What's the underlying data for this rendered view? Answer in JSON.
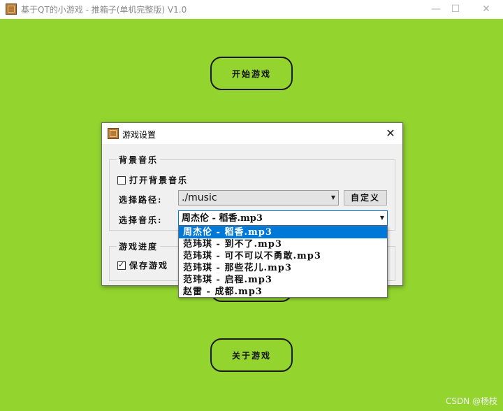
{
  "window": {
    "title": "基于QT的小游戏 - 推箱子(单机完整版) V1.0",
    "minimize": "—",
    "maximize": "☐",
    "close": "✕"
  },
  "main": {
    "start_button": "开始游戏",
    "about_button": "关于游戏"
  },
  "dialog": {
    "title": "游戏设置",
    "close": "✕",
    "music_group": {
      "title": "背景音乐",
      "enable_checkbox": {
        "label": "打开背景音乐",
        "checked": false
      },
      "path_label": "选择路径:",
      "path_value": "./music",
      "custom_button": "自定义",
      "music_label": "选择音乐:",
      "music_value": "周杰伦 - 稻香.mp3",
      "options": [
        "周杰伦 - 稻香.mp3",
        "范玮琪 - 到不了.mp3",
        "范玮琪 - 可不可以不勇敢.mp3",
        "范玮琪 - 那些花儿.mp3",
        "范玮琪 - 启程.mp3",
        "赵雷 - 成都.mp3"
      ],
      "selected_index": 0
    },
    "progress_group": {
      "title": "游戏进度",
      "save_checkbox": {
        "label": "保存游戏",
        "checked": true
      }
    }
  },
  "watermark": "CSDN @杨枝",
  "colors": {
    "background": "#93d42f",
    "selection": "#0078d7"
  }
}
